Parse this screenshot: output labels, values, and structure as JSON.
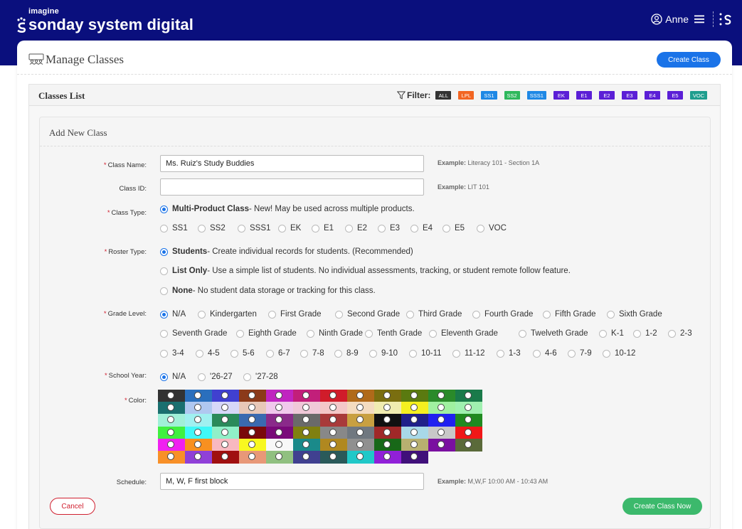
{
  "brand": {
    "small": "imagine",
    "big": "sonday system digital"
  },
  "user": {
    "name": "Anne"
  },
  "page": {
    "title": "Manage Classes",
    "create_button": "Create Class"
  },
  "list": {
    "title": "Classes List",
    "filter_label": "Filter:",
    "filters": [
      {
        "label": "ALL",
        "color": "#333333"
      },
      {
        "label": "LPL",
        "color": "#f26522"
      },
      {
        "label": "SS1",
        "color": "#1e88e5"
      },
      {
        "label": "SS2",
        "color": "#2eb85c"
      },
      {
        "label": "SSS1",
        "color": "#1e88e5"
      },
      {
        "label": "EK",
        "color": "#5b1fd6"
      },
      {
        "label": "E1",
        "color": "#5b1fd6"
      },
      {
        "label": "E2",
        "color": "#5b1fd6"
      },
      {
        "label": "E3",
        "color": "#5b1fd6"
      },
      {
        "label": "E4",
        "color": "#5b1fd6"
      },
      {
        "label": "E5",
        "color": "#5b1fd6"
      },
      {
        "label": "VOC",
        "color": "#1f9e8e"
      }
    ]
  },
  "form": {
    "title": "Add New Class",
    "class_name": {
      "label": "Class Name:",
      "value": "Ms. Ruiz's Study Buddies",
      "hint_prefix": "Example:",
      "hint": "Literacy 101 - Section 1A"
    },
    "class_id": {
      "label": "Class ID:",
      "value": "",
      "hint_prefix": "Example:",
      "hint": "LIT 101"
    },
    "class_type": {
      "label": "Class Type:",
      "multi_bold": "Multi-Product Class",
      "multi_rest": " - New! May be used across multiple products.",
      "products": [
        "SS1",
        "SS2",
        "SSS1",
        "EK",
        "E1",
        "E2",
        "E3",
        "E4",
        "E5",
        "VOC"
      ]
    },
    "roster_type": {
      "label": "Roster Type:",
      "options": [
        {
          "bold": "Students",
          "rest": " - Create individual records for students. (Recommended)",
          "selected": true
        },
        {
          "bold": "List Only",
          "rest": " - Use a simple list of students. No individual assessments, tracking, or student remote follow feature.",
          "selected": false
        },
        {
          "bold": "None",
          "rest": " - No student data storage or tracking for this class.",
          "selected": false
        }
      ]
    },
    "grade_level": {
      "label": "Grade Level:",
      "rows": [
        [
          "N/A",
          "Kindergarten",
          "First Grade",
          "Second Grade",
          "Third Grade",
          "Fourth Grade",
          "Fifth Grade",
          "Sixth Grade"
        ],
        [
          "Seventh Grade",
          "Eighth Grade",
          "Ninth Grade",
          "Tenth Grade",
          "Eleventh Grade",
          "Twelveth Grade",
          "K-1",
          "1-2",
          "2-3"
        ],
        [
          "3-4",
          "4-5",
          "5-6",
          "6-7",
          "7-8",
          "8-9",
          "9-10",
          "10-11",
          "11-12",
          "1-3",
          "4-6",
          "7-9",
          "10-12"
        ]
      ]
    },
    "school_year": {
      "label": "School Year:",
      "options": [
        "N/A",
        "'26-27",
        "'27-28"
      ]
    },
    "color": {
      "label": "Color:",
      "rows": [
        [
          "#333333",
          "#2a6fbd",
          "#4040d0",
          "#8b3a1a",
          "#c024c0",
          "#c21f7a",
          "#d01c2a",
          "#b06a1a",
          "#7a6e10",
          "#5a7a10",
          "#2a8a2a",
          "#1a7a4a"
        ],
        [
          "#1a6f6f",
          "#b0c8f0",
          "#d6d8f8",
          "#e8c8b8",
          "#f0c8ec",
          "#f0c8d8",
          "#f4c8c8",
          "#f4dcc0",
          "#f0ecb0",
          "#f4f020",
          "#a0f0a0",
          "#a0f0b0"
        ],
        [
          "#a0f0d8",
          "#a0f0f0",
          "#2a8a5a",
          "#3a6ab0",
          "#8a2a8a",
          "#6a6a6a",
          "#a83a3a",
          "#c8a040",
          "#111111",
          "#20208a",
          "#2020f0",
          "#208a20"
        ],
        [
          "#40f040",
          "#40f8f8",
          "#90f0c8",
          "#7a0a0a",
          "#7a0a7a",
          "#808010",
          "#888888",
          "#707880",
          "#a02828",
          "#a8d8e8",
          "#c8c8c8",
          "#f01818"
        ],
        [
          "#f020f0",
          "#f89020",
          "#f8b8c0",
          "#f8f820",
          "#f8f8f8",
          "#1a8a8a",
          "#b08820",
          "#909090",
          "#186818",
          "#b8b070",
          "#7a10a0",
          "#5a6a3a"
        ],
        [
          "#f89028",
          "#9040d8",
          "#a01010",
          "#e89878",
          "#90c080",
          "#404090",
          "#2a5a5a",
          "#20c8c8",
          "#9020d8",
          "#40107a"
        ]
      ]
    },
    "schedule": {
      "label": "Schedule:",
      "value": "M, W, F first block",
      "hint_prefix": "Example:",
      "hint": "M,W,F 10:00 AM - 10:43 AM"
    },
    "cancel": "Cancel",
    "create_now": "Create Class Now"
  }
}
